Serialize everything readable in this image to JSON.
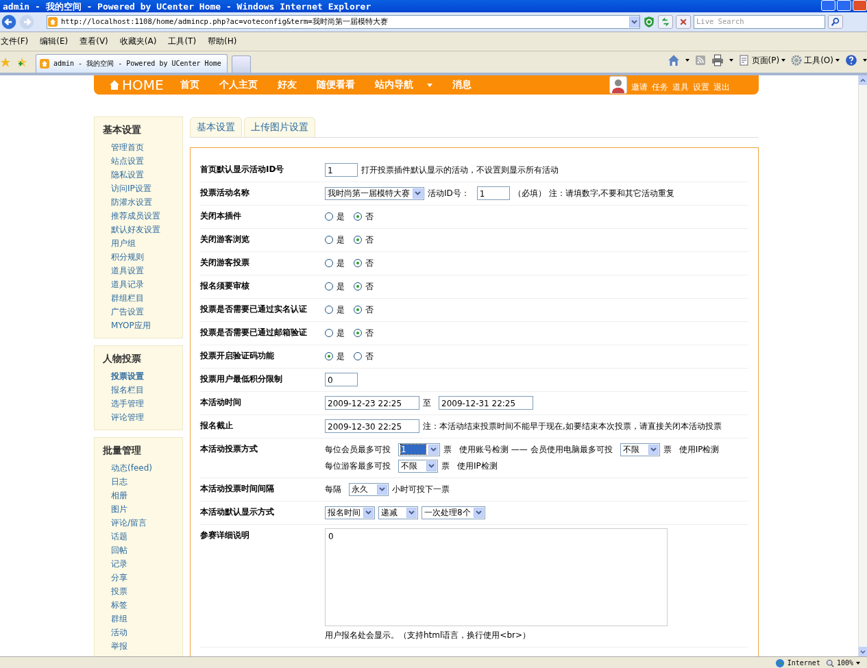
{
  "window": {
    "title": "admin - 我的空间 - Powered by UCenter Home - Windows Internet Explorer"
  },
  "address_bar": {
    "url": "http://localhost:1108/home/admincp.php?ac=voteconfig&term=我时尚第一届模特大赛",
    "search_placeholder": "Live Search"
  },
  "menu_bar": [
    "文件(F)",
    "编辑(E)",
    "查看(V)",
    "收藏夹(A)",
    "工具(T)",
    "帮助(H)"
  ],
  "tabs": [
    {
      "label": "admin - 我的空间 - Powered by UCenter Home",
      "selected": true
    }
  ],
  "command_bar": [
    "页面(P)",
    "工具(O)"
  ],
  "site_nav": {
    "logo": "HOME",
    "items": [
      {
        "label": "首页",
        "dropdown": false
      },
      {
        "label": "个人主页",
        "dropdown": false
      },
      {
        "label": "好友",
        "dropdown": false
      },
      {
        "label": "随便看看",
        "dropdown": false
      },
      {
        "label": "站内导航",
        "dropdown": true
      },
      {
        "label": "消息",
        "dropdown": false
      }
    ],
    "user_links": [
      "邀请",
      "任务",
      "道具",
      "设置",
      "退出"
    ]
  },
  "sidebar": [
    {
      "title": "基本设置",
      "items": [
        {
          "label": "管理首页",
          "selected": false
        },
        {
          "label": "站点设置",
          "selected": false
        },
        {
          "label": "隐私设置",
          "selected": false
        },
        {
          "label": "访问IP设置",
          "selected": false
        },
        {
          "label": "防灌水设置",
          "selected": false
        },
        {
          "label": "推荐成员设置",
          "selected": false
        },
        {
          "label": "默认好友设置",
          "selected": false
        },
        {
          "label": "用户组",
          "selected": false
        },
        {
          "label": "积分规则",
          "selected": false
        },
        {
          "label": "道具设置",
          "selected": false
        },
        {
          "label": "道具记录",
          "selected": false
        },
        {
          "label": "群组栏目",
          "selected": false
        },
        {
          "label": "广告设置",
          "selected": false
        },
        {
          "label": "MYOP应用",
          "selected": false
        }
      ]
    },
    {
      "title": "人物投票",
      "items": [
        {
          "label": "投票设置",
          "selected": true
        },
        {
          "label": "报名栏目",
          "selected": false
        },
        {
          "label": "选手管理",
          "selected": false
        },
        {
          "label": "评论管理",
          "selected": false
        }
      ]
    },
    {
      "title": "批量管理",
      "items": [
        {
          "label": "动态(feed)",
          "selected": false
        },
        {
          "label": "日志",
          "selected": false
        },
        {
          "label": "相册",
          "selected": false
        },
        {
          "label": "图片",
          "selected": false
        },
        {
          "label": "评论/留言",
          "selected": false
        },
        {
          "label": "话题",
          "selected": false
        },
        {
          "label": "回帖",
          "selected": false
        },
        {
          "label": "记录",
          "selected": false
        },
        {
          "label": "分享",
          "selected": false
        },
        {
          "label": "投票",
          "selected": false
        },
        {
          "label": "标签",
          "selected": false
        },
        {
          "label": "群组",
          "selected": false
        },
        {
          "label": "活动",
          "selected": false
        },
        {
          "label": "举报",
          "selected": false
        }
      ]
    }
  ],
  "content_tabs": [
    "基本设置",
    "上传图片设置"
  ],
  "form": {
    "rows": [
      {
        "label": "首页默认显示活动ID号",
        "lines": [
          [
            {
              "kind": "input",
              "value": "1"
            },
            {
              "kind": "text",
              "text": "打开投票插件默认显示的活动，不设置则显示所有活动"
            }
          ]
        ]
      },
      {
        "label": "投票活动名称",
        "lines": [
          [
            {
              "kind": "select",
              "value": "我时尚第一届模特大赛",
              "highlighted": false
            },
            {
              "kind": "text",
              "text": "活动ID号："
            },
            {
              "kind": "input",
              "value": "1"
            },
            {
              "kind": "text",
              "text": "（必填） 注：请填数字,不要和其它活动重复"
            }
          ]
        ]
      },
      {
        "label": "关闭本插件",
        "lines": [
          [
            {
              "kind": "radio",
              "label": "是",
              "selected": false
            },
            {
              "kind": "radio",
              "label": "否",
              "selected": true
            }
          ]
        ]
      },
      {
        "label": "关闭游客浏览",
        "lines": [
          [
            {
              "kind": "radio",
              "label": "是",
              "selected": false
            },
            {
              "kind": "radio",
              "label": "否",
              "selected": true
            }
          ]
        ]
      },
      {
        "label": "关闭游客投票",
        "lines": [
          [
            {
              "kind": "radio",
              "label": "是",
              "selected": false
            },
            {
              "kind": "radio",
              "label": "否",
              "selected": true
            }
          ]
        ]
      },
      {
        "label": "报名须要审核",
        "lines": [
          [
            {
              "kind": "radio",
              "label": "是",
              "selected": false
            },
            {
              "kind": "radio",
              "label": "否",
              "selected": true
            }
          ]
        ]
      },
      {
        "label": "投票是否需要已通过实名认证",
        "lines": [
          [
            {
              "kind": "radio",
              "label": "是",
              "selected": false
            },
            {
              "kind": "radio",
              "label": "否",
              "selected": true
            }
          ]
        ]
      },
      {
        "label": "投票是否需要已通过邮箱验证",
        "lines": [
          [
            {
              "kind": "radio",
              "label": "是",
              "selected": false
            },
            {
              "kind": "radio",
              "label": "否",
              "selected": true
            }
          ]
        ]
      },
      {
        "label": "投票开启验证码功能",
        "lines": [
          [
            {
              "kind": "radio",
              "label": "是",
              "selected": true
            },
            {
              "kind": "radio",
              "label": "否",
              "selected": false
            }
          ]
        ]
      },
      {
        "label": "投票用户最低积分限制",
        "lines": [
          [
            {
              "kind": "input",
              "value": "0"
            }
          ]
        ]
      },
      {
        "label": "本活动时间",
        "lines": [
          [
            {
              "kind": "input",
              "value": "2009-12-23 22:25"
            },
            {
              "kind": "text",
              "text": "至"
            },
            {
              "kind": "input",
              "value": "2009-12-31 22:25"
            }
          ]
        ]
      },
      {
        "label": "报名截止",
        "lines": [
          [
            {
              "kind": "input",
              "value": "2009-12-30 22:25"
            },
            {
              "kind": "text",
              "text": "注：本活动结束投票时间不能早于现在,如要结束本次投票，请直接关闭本活动投票"
            }
          ]
        ]
      },
      {
        "label": "本活动投票方式",
        "lines": [
          [
            {
              "kind": "text",
              "text": "每位会员最多可投"
            },
            {
              "kind": "select",
              "value": "1",
              "highlighted": true
            },
            {
              "kind": "text",
              "text": "票"
            },
            {
              "kind": "text",
              "text": "使用账号检测 —— 会员使用电脑最多可投"
            },
            {
              "kind": "select",
              "value": "不限",
              "highlighted": false
            },
            {
              "kind": "text",
              "text": "票"
            },
            {
              "kind": "text",
              "text": "使用IP检测"
            }
          ],
          [
            {
              "kind": "text",
              "text": "每位游客最多可投"
            },
            {
              "kind": "select",
              "value": "不限",
              "highlighted": false
            },
            {
              "kind": "text",
              "text": "票"
            },
            {
              "kind": "text",
              "text": "使用IP检测"
            }
          ]
        ]
      },
      {
        "label": "本活动投票时间间隔",
        "lines": [
          [
            {
              "kind": "text",
              "text": "每隔"
            },
            {
              "kind": "select",
              "value": "永久",
              "highlighted": false
            },
            {
              "kind": "text",
              "text": "小时可投下一票"
            }
          ]
        ]
      },
      {
        "label": "本活动默认显示方式",
        "lines": [
          [
            {
              "kind": "select",
              "value": "报名时间",
              "highlighted": false
            },
            {
              "kind": "select",
              "value": "递减",
              "highlighted": false
            },
            {
              "kind": "select",
              "value": "一次处理8个",
              "highlighted": false
            }
          ]
        ]
      },
      {
        "label": "参赛详细说明",
        "lines": [
          [
            {
              "kind": "textarea",
              "value": "0"
            }
          ],
          [
            {
              "kind": "text",
              "text": "用户报名处会显示。（支持html语言，换行使用<br>）"
            }
          ]
        ]
      }
    ]
  },
  "status_bar": {
    "zone": "Internet",
    "zoom": "100%"
  }
}
